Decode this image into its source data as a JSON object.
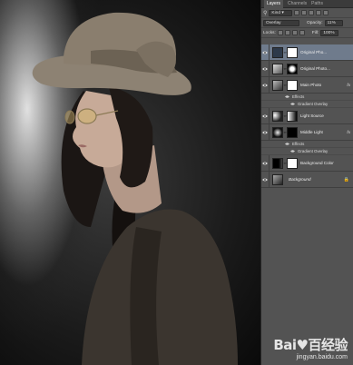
{
  "panel": {
    "tabs": [
      "Layers",
      "Channels",
      "Paths"
    ],
    "filter_kind": "Kind",
    "blend_mode": "Overlay",
    "opacity_label": "Opacity:",
    "opacity_value": "11%",
    "lock_label": "Locks:",
    "fill_label": "Fill:",
    "fill_value": "100%"
  },
  "layers": [
    {
      "name": "Original Pho..."
    },
    {
      "name": "Original Photo..."
    },
    {
      "name": "Main Photo",
      "fx": "fx",
      "effects": [
        "Effects",
        "Gradient Overlay"
      ]
    },
    {
      "name": "Light Source"
    },
    {
      "name": "Middle Light",
      "fx": "fx",
      "effects": [
        "Effects",
        "Gradient Overlay"
      ]
    },
    {
      "name": "Background Color"
    },
    {
      "name": "Background"
    }
  ],
  "watermark": {
    "logo": "Bai♥百经验",
    "url": "jingyan.baidu.com"
  },
  "colors": {
    "panel_bg": "#535353",
    "selected_layer": "#6f7b8c",
    "tab_bar": "#3b3b3b"
  }
}
